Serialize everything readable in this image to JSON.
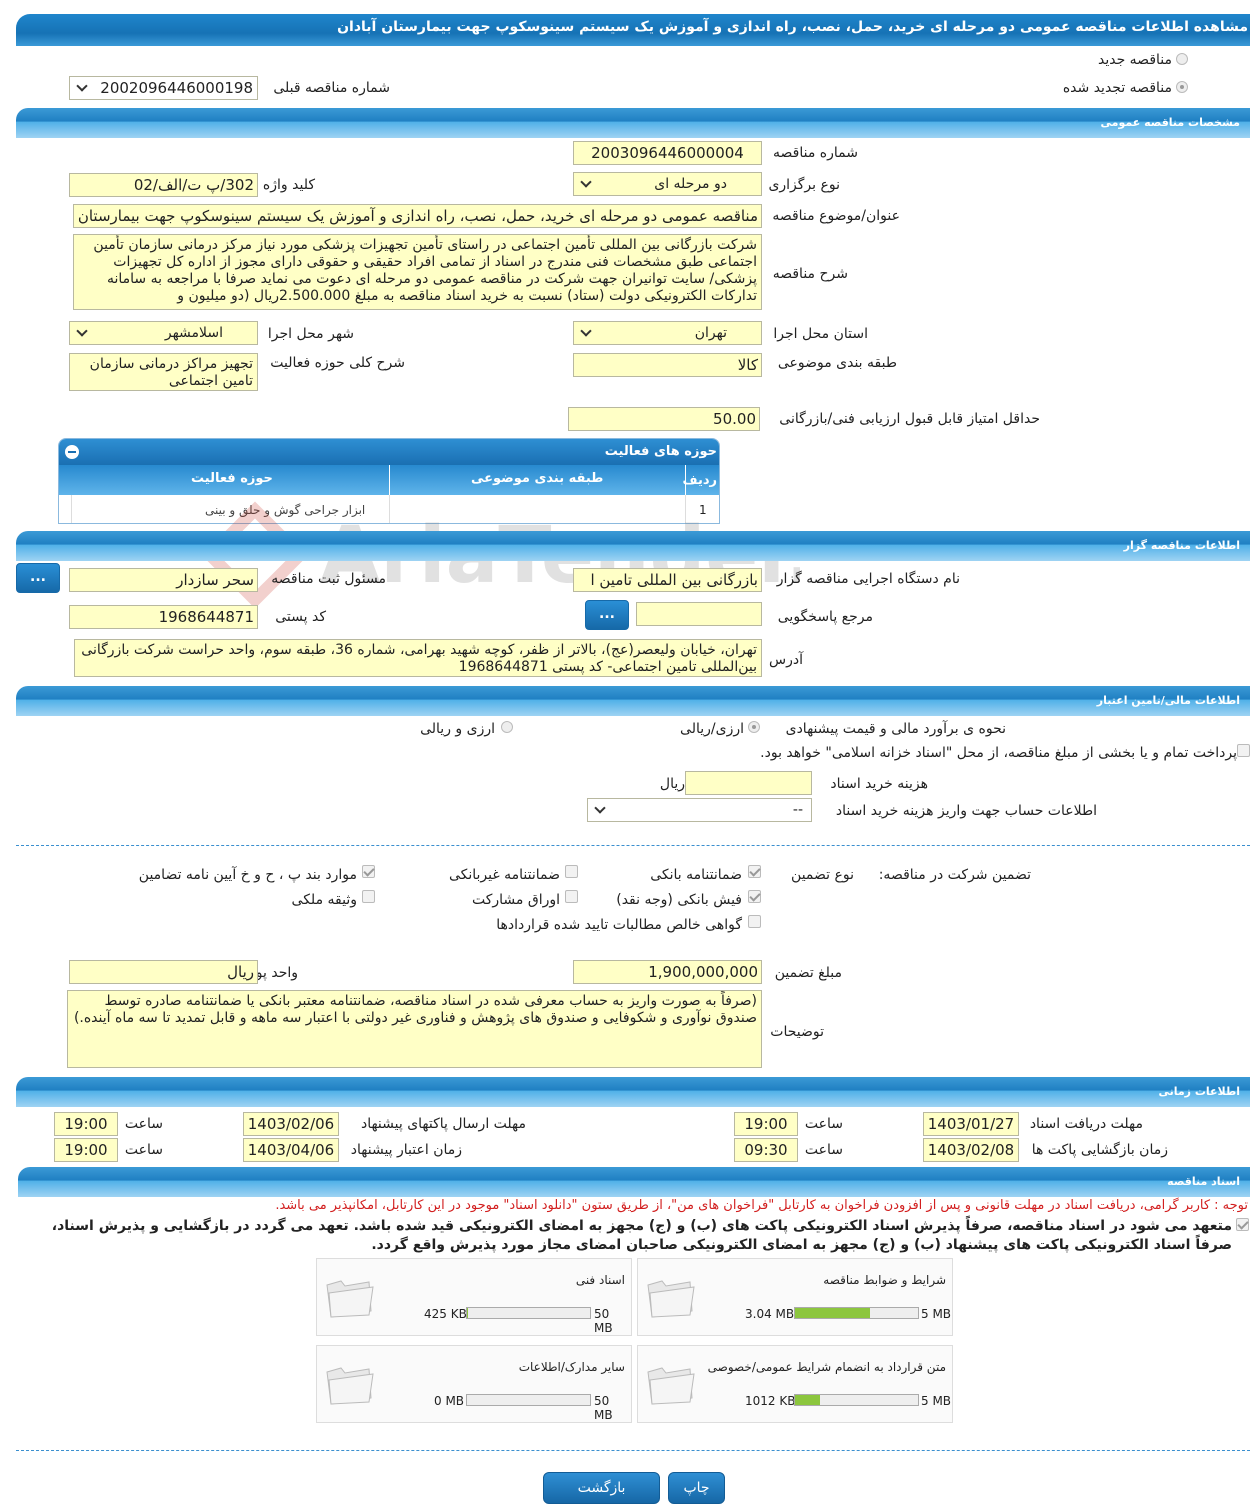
{
  "header": {
    "title": "مشاهده اطلاعات مناقصه عمومی دو مرحله ای خرید، حمل، نصب، راه اندازی و آموزش یک سیستم سینوسکوپ جهت بیمارستان آبادان"
  },
  "tender_type": {
    "new_label": "مناقصه جدید",
    "renewed_label": "مناقصه تجدید شده",
    "prev_number_label": "شماره مناقصه قبلی",
    "prev_number": "2002096446000198"
  },
  "general": {
    "section_title": "مشخصات مناقصه عمومی",
    "number_label": "شماره مناقصه",
    "number": "2003096446000004",
    "type_label": "نوع برگزاری",
    "type": "دو مرحله ای",
    "keyword_label": "کلید واژه",
    "keyword": "302/پ ت/الف/02",
    "subject_label": "عنوان/موضوع مناقصه",
    "subject": "مناقصه عمومی دو مرحله ای خرید، حمل، نصب، راه اندازی و آموزش یک سیستم سینوسکوپ جهت بیمارستان آبادان",
    "desc_label": "شرح مناقصه",
    "desc": "شرکت بازرگانی بین المللی تأمین اجتماعی در راستای تأمین تجهیزات پزشکی مورد نیاز مرکز درمانی سازمان تأمین اجتماعی طبق مشخصات فنی مندرج در اسناد از تمامی افراد حقیقی و حقوقی دارای مجوز از اداره کل تجهیزات پزشکی/ سایت توانیران جهت شرکت در مناقصه عمومی دو مرحله ای دعوت می نماید صرفا با مراجعه به سامانه تدارکات الکترونیکی دولت (ستاد) نسبت به خرید اسناد مناقصه به مبلغ 2.500.000ریال (دو میلیون و",
    "province_label": "استان محل اجرا",
    "province": "تهران",
    "city_label": "شهر محل اجرا",
    "city": "اسلامشهر",
    "category_label": "طبقه بندی موضوعی",
    "category": "کالا",
    "activity_desc_label": "شرح کلی حوزه فعالیت",
    "activity_desc": "تجهیز مراکز درمانی سازمان تامین اجتماعی",
    "min_score_label": "حداقل امتیاز قابل قبول ارزیابی فنی/بازرگانی",
    "min_score": "50.00"
  },
  "activities": {
    "title": "حوزه های فعالیت",
    "col_row": "ردیف",
    "col_category": "طبقه بندی موضوعی",
    "col_field": "حوزه فعالیت",
    "rows": [
      {
        "row": "1",
        "category": "",
        "field": "ابزار جراحی گوش و حلق و بینی"
      }
    ]
  },
  "organizer": {
    "section_title": "اطلاعات مناقصه گزار",
    "org_label": "نام دستگاه اجرایی مناقصه گزار",
    "org": "بازرگانی بین المللی تامین ا",
    "registrar_label": "مسئول ثبت مناقصه",
    "registrar": "سحر سازدار",
    "ref_label": "مرجع پاسخگویی",
    "ref": "",
    "postal_label": "کد پستی",
    "postal": "1968644871",
    "address_label": "آدرس",
    "address": "تهران، خیابان ولیعصر(عج)، بالاتر از ظفر، کوچه شهید بهرامی، شماره 36، طبقه سوم، واحد حراست شرکت بازرگانی بین‌المللی تامین اجتماعی- کد پستی 1968644871",
    "dots": "..."
  },
  "finance": {
    "section_title": "اطلاعات مالی/تامین اعتبار",
    "method_label": "نحوه ی برآورد مالی و قیمت پیشنهادی",
    "rial_label": "ارزی/ریالی",
    "fx_label": "ارزی و ریالی",
    "treasury_label": "پرداخت تمام و یا بخشی از مبلغ مناقصه، از محل \"اسناد خزانه اسلامی\" خواهد بود.",
    "doc_fee_label": "هزینه خرید اسناد",
    "doc_fee": "",
    "currency": "ریال",
    "account_label": "اطلاعات حساب جهت واریز هزینه خرید اسناد",
    "account": "--"
  },
  "guarantee": {
    "label": "تضمین شرکت در مناقصه:",
    "type_label": "نوع تضمین",
    "bank_guarantee": "ضمانتنامه بانکی",
    "nonbank_guarantee": "ضمانتنامه غیربانکی",
    "clauses": "موارد بند پ ، ح و خ آیین نامه تضامین",
    "bank_receipt": "فیش بانکی (وجه نقد)",
    "bonds": "اوراق مشارکت",
    "property": "وثیقه ملکی",
    "claims": "گواهی خالص مطالبات تایید شده قراردادها",
    "amount_label": "مبلغ تضمین",
    "amount": "1,900,000,000",
    "unit_label": "واحد پول",
    "unit": "ریال",
    "notes_label": "توضیحات",
    "notes": "(صرفاً به صورت واریز به حساب معرفی شده در اسناد مناقصه، ضمانتنامه معتبر بانکی یا ضمانتنامه صادره توسط صندوق نوآوری و شکوفایی و صندوق های پژوهش و فناوری غیر دولتی با اعتبار سه ماهه و قابل تمدید تا سه ماه آینده.)"
  },
  "timing": {
    "section_title": "اطلاعات زمانی",
    "receive_label": "مهلت دریافت اسناد",
    "receive_date": "1403/01/27",
    "receive_time": "19:00",
    "send_label": "مهلت ارسال پاکتهای پیشنهاد",
    "send_date": "1403/02/06",
    "send_time": "19:00",
    "open_label": "زمان بازگشایی پاکت ها",
    "open_date": "1403/02/08",
    "open_time": "09:30",
    "valid_label": "زمان اعتبار پیشنهاد",
    "valid_date": "1403/04/06",
    "valid_time": "19:00",
    "time_label": "ساعت"
  },
  "docs": {
    "section_title": "اسناد مناقصه",
    "note": "توجه : کاربر گرامی، دریافت اسناد در مهلت قانونی و پس از افزودن فراخوان به کارتابل \"فراخوان های من\"، از طریق ستون \"دانلود اسناد\" موجود در این کارتابل، امکانپذیر می باشد.",
    "commit": "متعهد می شود در اسناد مناقصه، صرفاً پذیرش اسناد الکترونیکی پاکت های (ب) و (ج) مجهز به امضای الکترونیکی قید شده باشد. تعهد می گردد در بازگشایی و پذیرش اسناد، صرفاً اسناد الکترونیکی پاکت های پیشنهاد (ب) و (ج) مجهز به امضای الکترونیکی صاحبان امضای مجاز مورد پذیرش واقع گردد.",
    "files": [
      {
        "name": "شرایط و ضوابط مناقصه",
        "size": "3.04 MB",
        "max": "5 MB",
        "used": 0.61
      },
      {
        "name": "اسناد فنی",
        "size": "425 KB",
        "max": "50 MB",
        "used": 0.01
      },
      {
        "name": "متن قرارداد به انضمام شرایط عمومی/خصوصی",
        "size": "1012 KB",
        "max": "5 MB",
        "used": 0.2
      },
      {
        "name": "سایر مدارک/اطلاعات",
        "size": "0 MB",
        "max": "50 MB",
        "used": 0
      }
    ]
  },
  "buttons": {
    "print": "چاپ",
    "back": "بازگشت"
  },
  "watermark": "AriaTender.neT"
}
